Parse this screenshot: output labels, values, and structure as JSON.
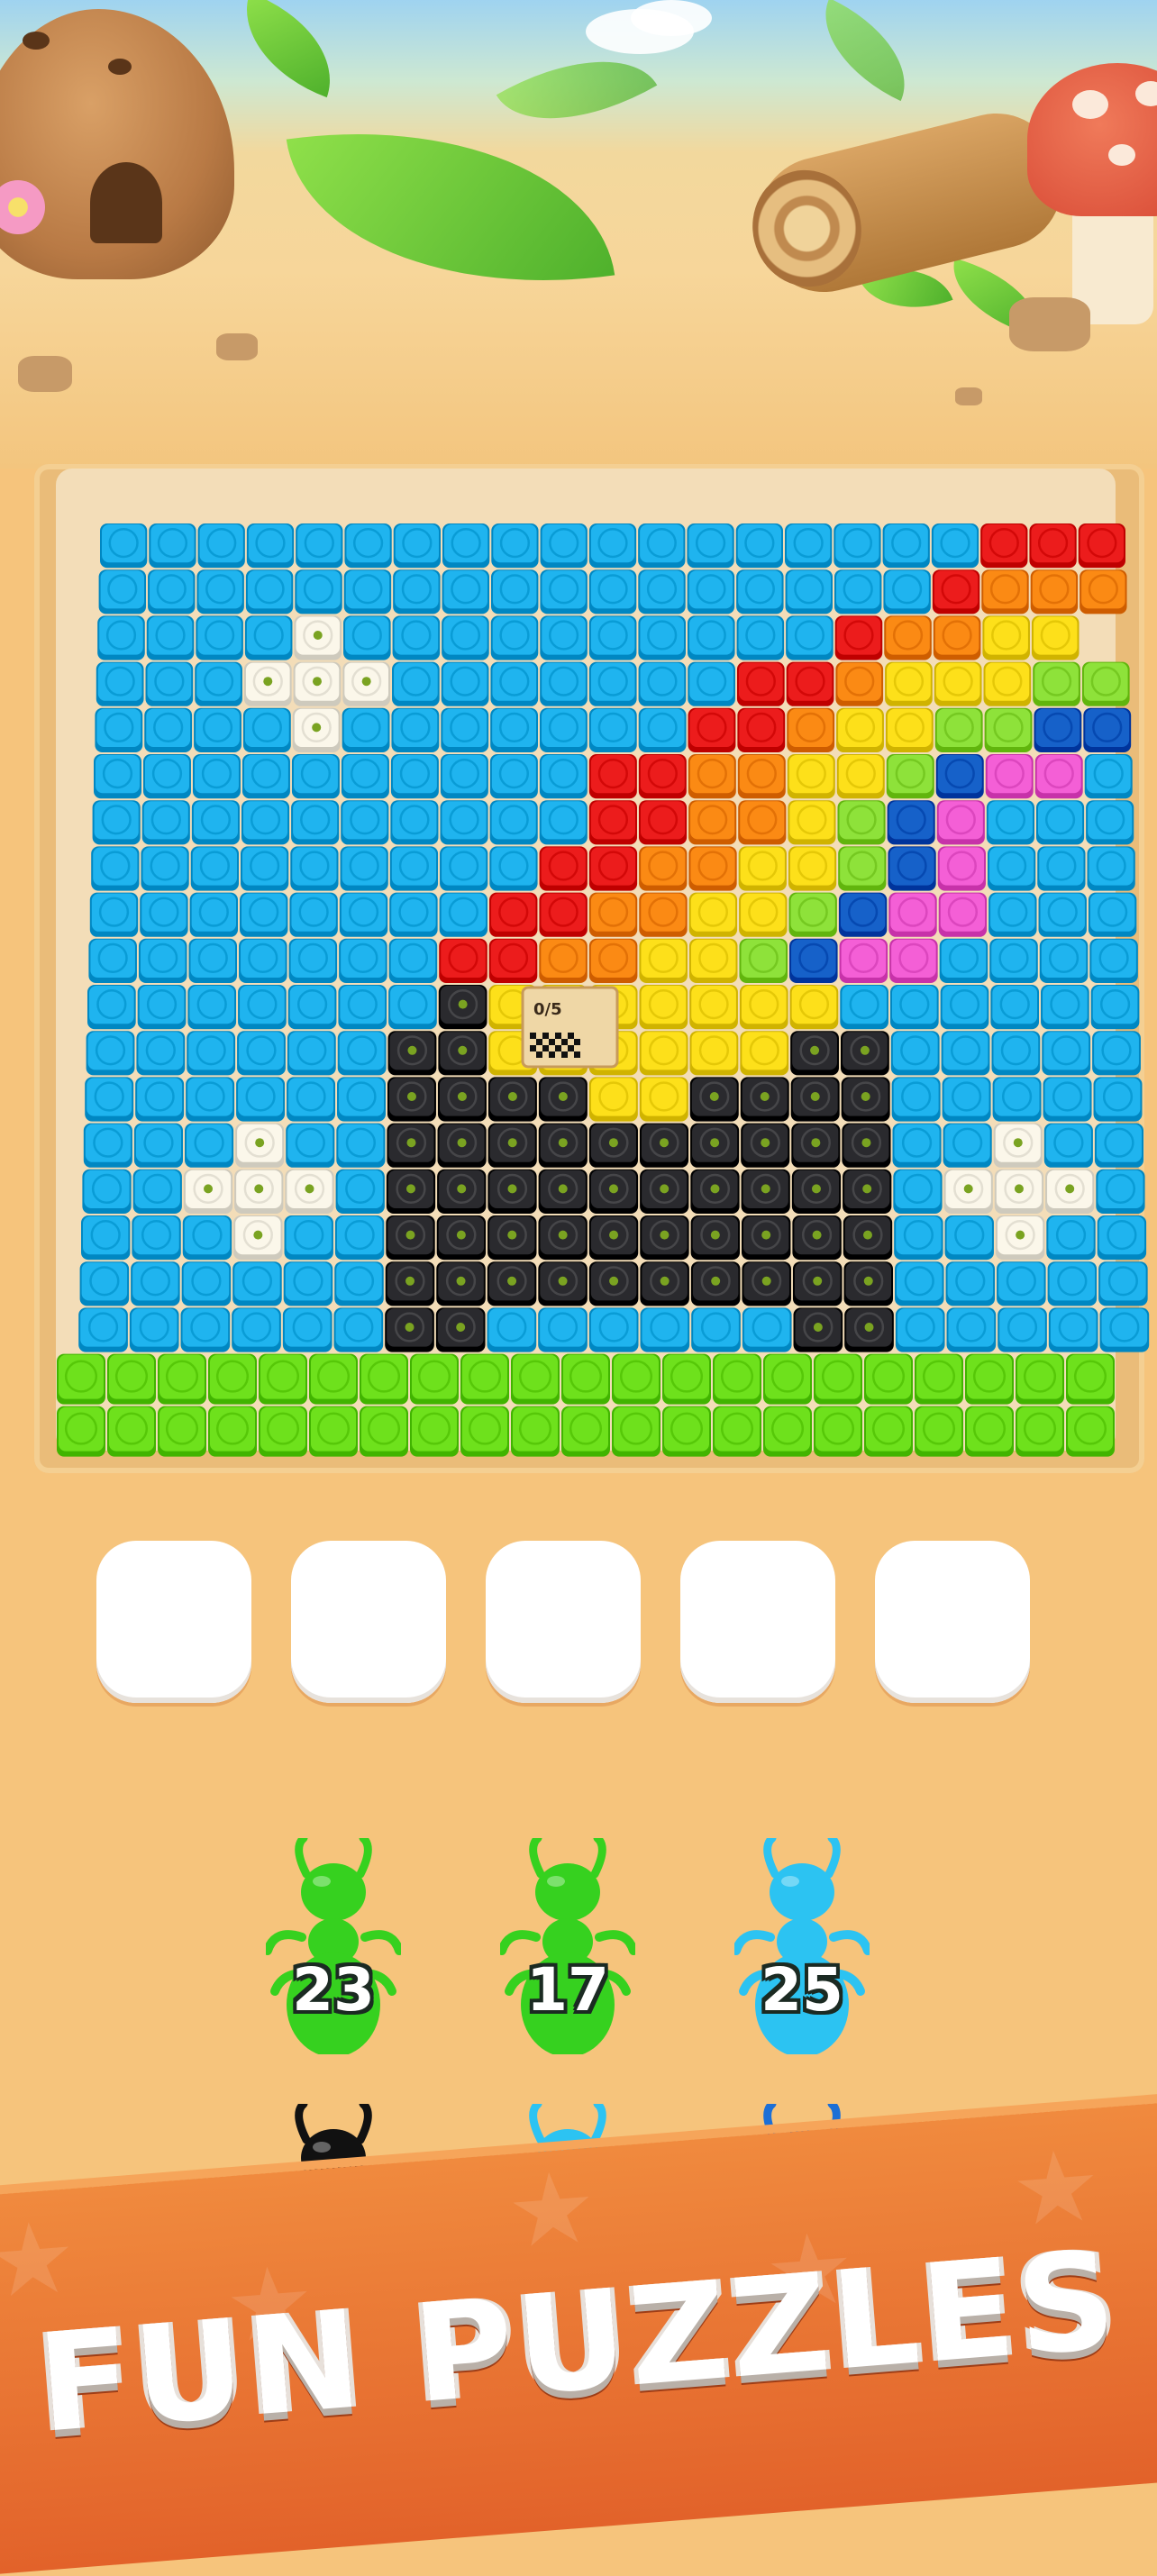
{
  "board": {
    "rows": [
      "BBBBBBBBBBBBBBBBBBRRR",
      "BBBBBBBBBBBBBBBBBROOO",
      "BBBBWBBBBBBBBBBROOYY",
      "BBBWWWBBBBBBBRROYYYGG",
      "BBBBWBBBBBBBRROYYGGNN",
      "BBBBBBBBBBRROOYYGNPPB",
      "BBBBBBBBBBRROOYGNPBBB",
      "BBBBBBBBBRROOYYGNPBBB",
      "BBBBBBBBRROOYYGNPPBBB",
      "BBBBBBBRROOYYGNPPBBBB",
      "BBBBBBBKYYYYYYYBBBBBB",
      "BBBBBBKKYYYYYYKKBBBBB",
      "BBBBBBKKKKYYKKKKBBBBB",
      "BBBWBBKKKKKKKKKKBBWBB",
      "BBWWWBKKKKKKKKKKBWWWB",
      "BBBWBBKKKKKKKKKKBBWBB",
      "BBBBBBKKKKKKKKKKBBBBB",
      "BBBBBBKKBBBBBBKKBBBBB",
      "LLLLLLLLLLLLLLLLLLLLL",
      "LLLLLLLLLLLLLLLLLLLLL"
    ],
    "palette": {
      "B": "#1fb4ef",
      "R": "#ec1c1c",
      "O": "#fb8a14",
      "Y": "#fde01a",
      "G": "#8ee23a",
      "N": "#1661c9",
      "P": "#f45fd6",
      "W": "#fbf7ea",
      "K": "#2a2a2e",
      "L": "#6ee11c"
    },
    "goal_card": {
      "progress": "0/5",
      "icon": "checkered-flag-icon"
    }
  },
  "slots": [
    {
      "label": ""
    },
    {
      "label": ""
    },
    {
      "label": ""
    },
    {
      "label": ""
    },
    {
      "label": ""
    }
  ],
  "ants": [
    {
      "count": "23",
      "color": "#36d11f",
      "icon": "ant-icon"
    },
    {
      "count": "17",
      "color": "#36d11f",
      "icon": "ant-icon"
    },
    {
      "count": "25",
      "color": "#2cc3f2",
      "icon": "ant-icon"
    },
    {
      "count": "",
      "color": "#111111",
      "icon": "ant-icon"
    },
    {
      "count": "",
      "color": "#2cc3f2",
      "icon": "ant-icon"
    },
    {
      "count": "",
      "color": "#1c6fd6",
      "icon": "ant-icon"
    }
  ],
  "banner": {
    "text": "FUN PUZZLES"
  }
}
